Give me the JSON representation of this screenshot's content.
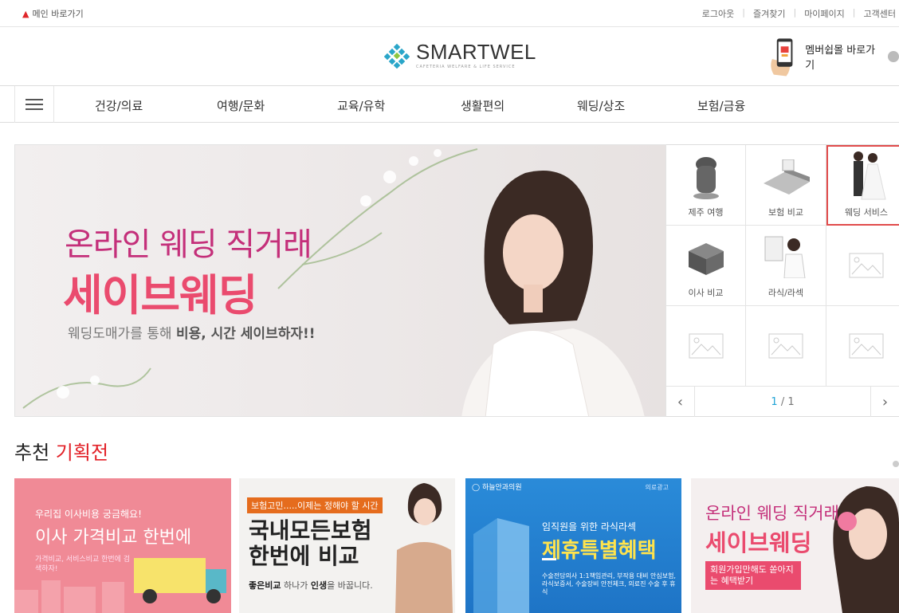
{
  "topbar": {
    "home_label": "메인 바로가기",
    "links": [
      "로그아웃",
      "즐겨찾기",
      "마이페이지",
      "고객센터"
    ]
  },
  "header": {
    "brand": "SMARTWEL",
    "tagline": "CAFETERIA WELFARE & LIFE SERVICE",
    "member_label": "멤버쉽몰 바로가기"
  },
  "nav": {
    "items": [
      "건강/의료",
      "여행/문화",
      "교육/유학",
      "생활편의",
      "웨딩/상조",
      "보험/금융"
    ]
  },
  "banner": {
    "line1": "온라인 웨딩 직거래",
    "line2": "세이브웨딩",
    "sub_pre": "웨딩도매가를 통해 ",
    "sub_bold": "비용, 시간 세이브하자!!"
  },
  "quick": {
    "items": [
      {
        "label": "제주 여행",
        "icon": "stone-statue-icon"
      },
      {
        "label": "보험 비교",
        "icon": "calculator-icon"
      },
      {
        "label": "웨딩 서비스",
        "icon": "wedding-couple-icon",
        "selected": true
      },
      {
        "label": "이사 비교",
        "icon": "moving-box-icon"
      },
      {
        "label": "라식/라섹",
        "icon": "eye-doctor-icon"
      },
      {
        "label": "",
        "icon": "image-placeholder-icon"
      },
      {
        "label": "",
        "icon": "image-placeholder-icon"
      },
      {
        "label": "",
        "icon": "image-placeholder-icon"
      },
      {
        "label": "",
        "icon": "image-placeholder-icon"
      }
    ],
    "page_current": "1",
    "page_total": "/ 1",
    "prev": "‹",
    "next": "›"
  },
  "section": {
    "title_pre": "추천 ",
    "title_red": "기획전"
  },
  "cards": {
    "moving": {
      "t1": "우리집 이사비용 궁금해요!",
      "t2": "이사 가격비교 한번에",
      "t3": "가격비교, 서비스비교 한번에 검색하자!"
    },
    "insurance": {
      "tag": "보험고민.....이제는 정해야 할 시간",
      "t1": "국내모든보험 한번에 비교",
      "t2_bold1": "좋은비교",
      "t2_mid": " 하나가 ",
      "t2_bold2": "인생",
      "t2_end": "을 바꿉니다."
    },
    "eye": {
      "hospital": "하늘안과의원",
      "ad": "의료광고",
      "t1": "임직원을 위한 라식라섹",
      "t2": "제휴특별혜택",
      "t3": "수술전담의사 1:1책임관리, 부작용 대비 안심보험, 라식보증서, 수술장비 안전체크, 의료진 수술 후 휴식"
    },
    "wedding": {
      "t1": "온라인 웨딩 직거래",
      "t2": "세이브웨딩",
      "t3": "회원가입만해도 쏟아지는 혜택받기"
    }
  },
  "colors": {
    "accent_red": "#e21f26",
    "pink": "#ea4b6e",
    "magenta": "#c42f7a",
    "blue": "#1fa3d6",
    "logo_teal": "#2aa6c9"
  }
}
